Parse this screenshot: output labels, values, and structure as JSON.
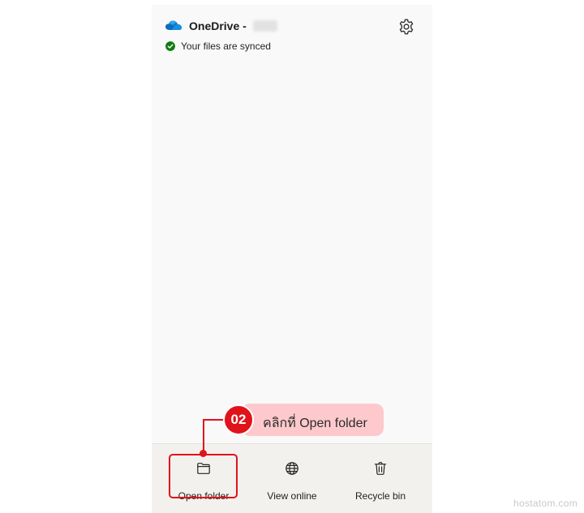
{
  "header": {
    "app_title": "OneDrive -",
    "status_text": "Your files are synced"
  },
  "footer": {
    "open_folder_label": "Open folder",
    "view_online_label": "View online",
    "recycle_bin_label": "Recycle bin"
  },
  "annotation": {
    "step_number": "02",
    "instruction": "คลิกที่ Open folder"
  },
  "watermark": "hostatom.com",
  "colors": {
    "accent_red": "#e0131b",
    "callout_pink": "#fdc9cc",
    "onedrive_blue": "#0f6cbd",
    "synced_green": "#0f7b0f"
  },
  "icons": [
    "onedrive-cloud-icon",
    "gear-icon",
    "check-icon",
    "folder-icon",
    "globe-icon",
    "trash-icon"
  ]
}
